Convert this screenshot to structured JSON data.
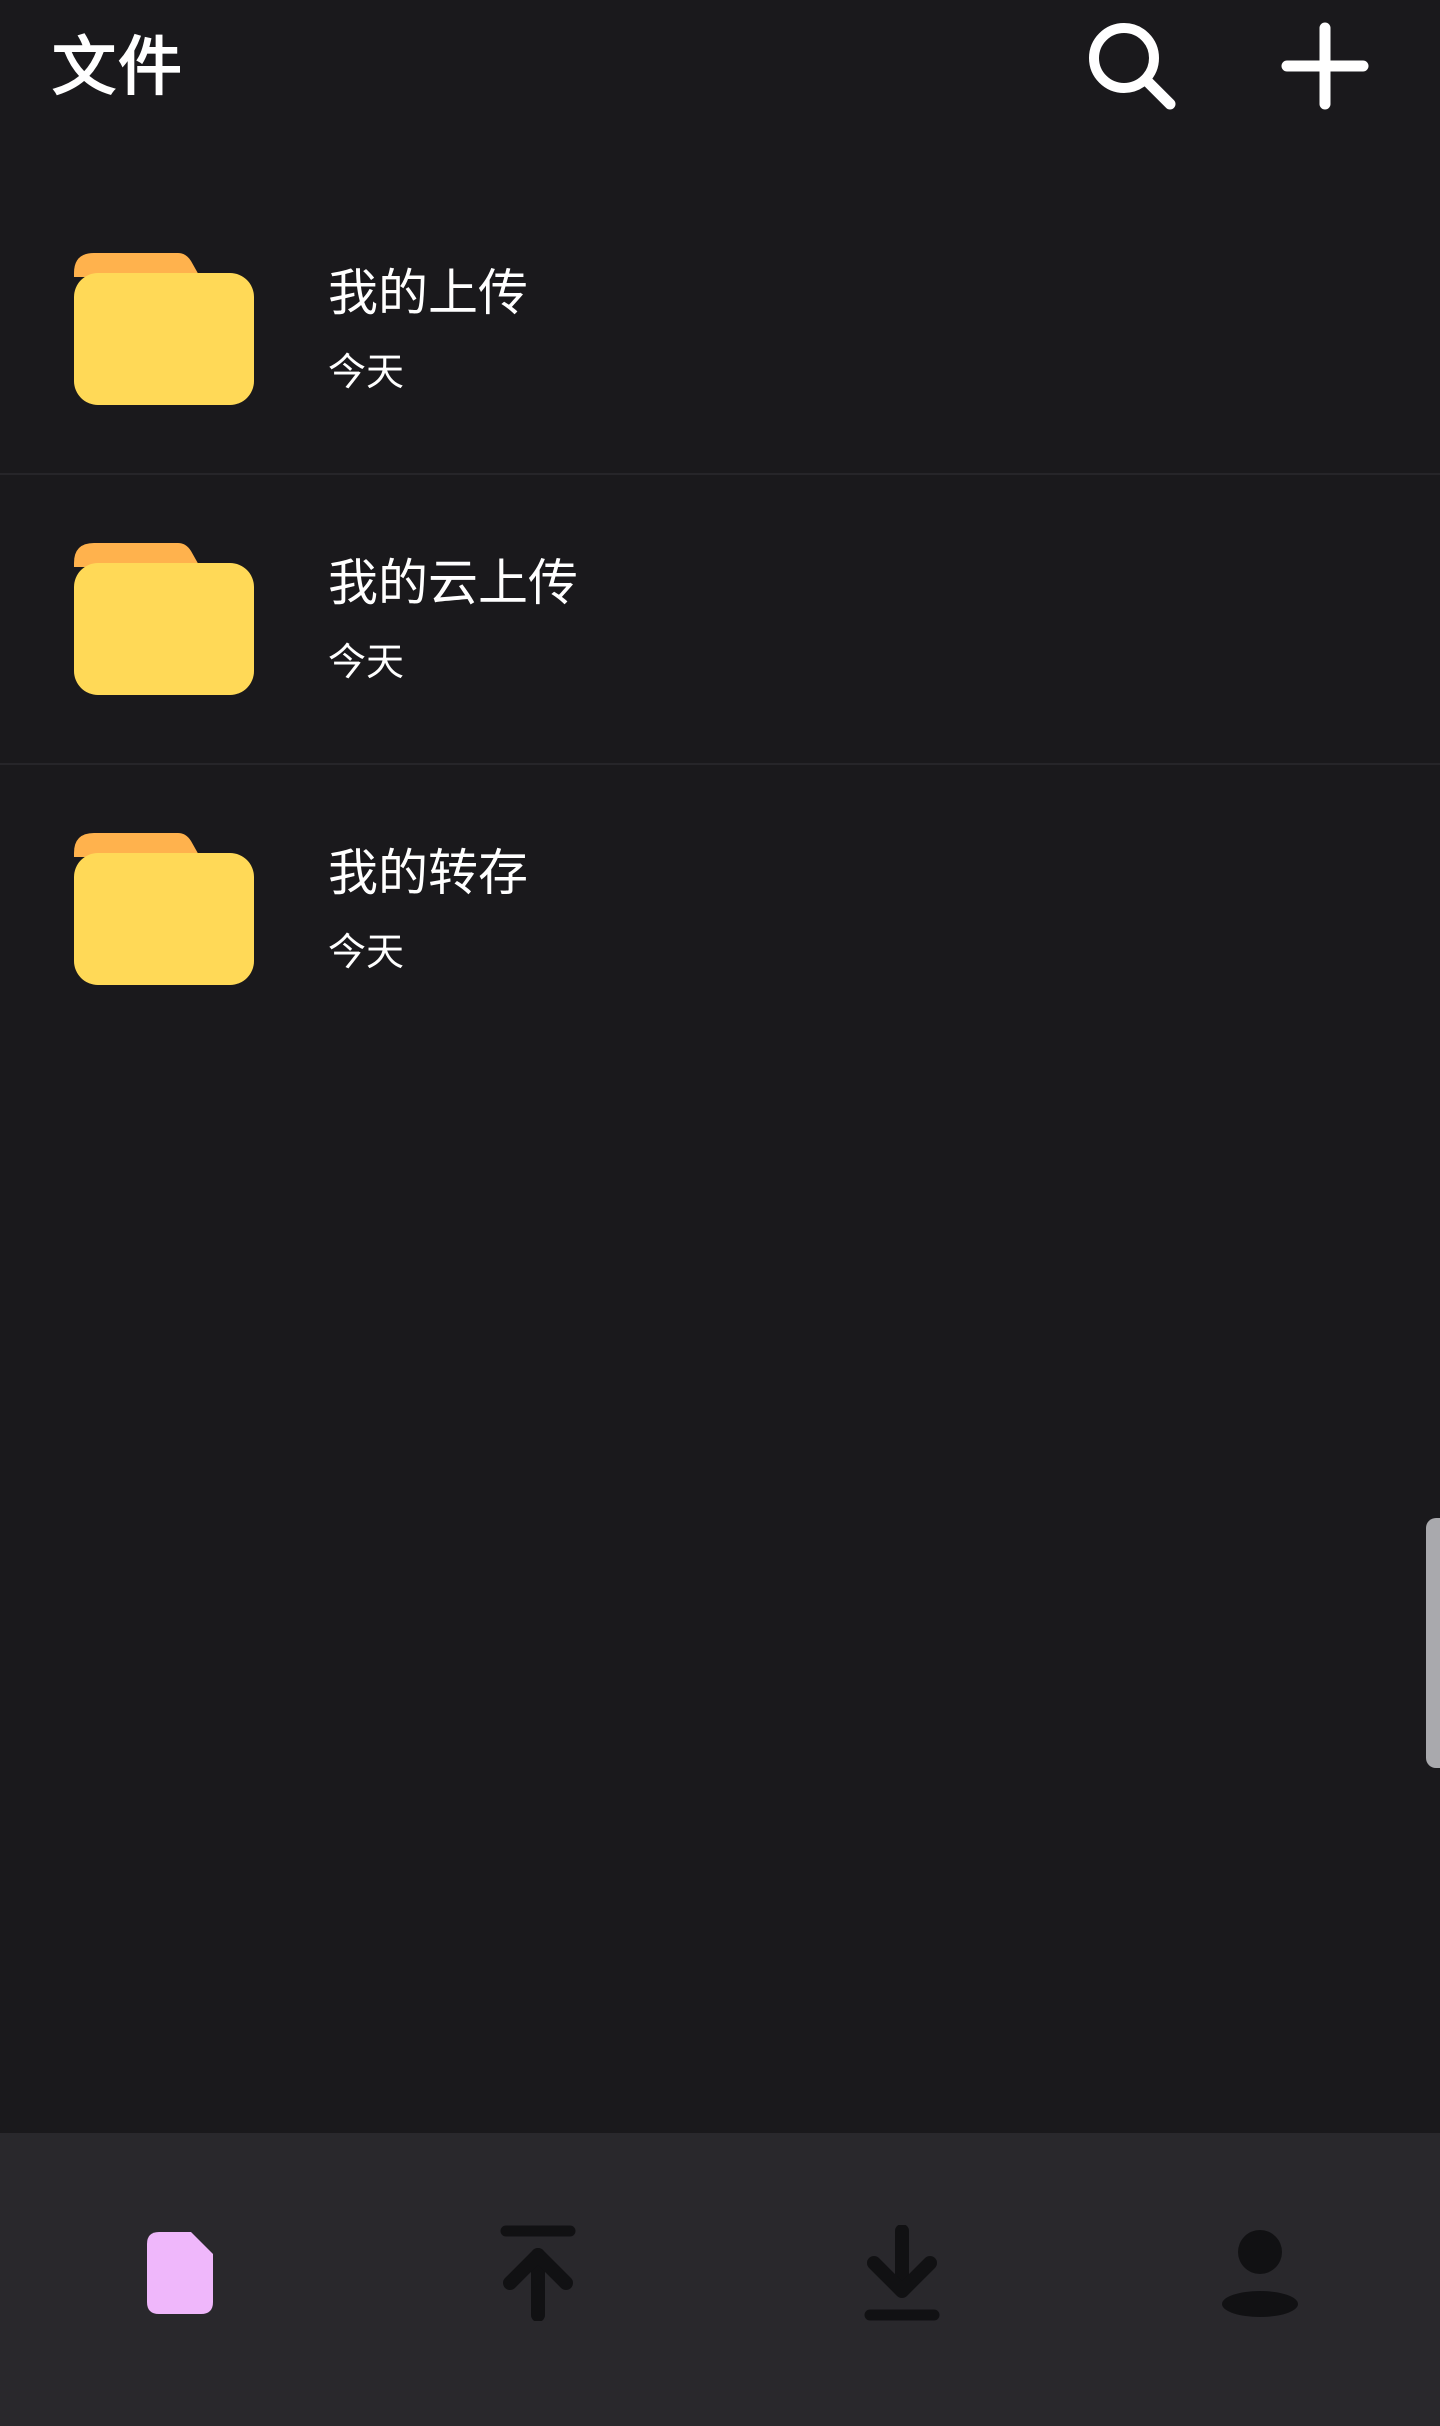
{
  "header": {
    "title": "文件",
    "search_icon": "search-icon",
    "add_icon": "plus-icon"
  },
  "files": [
    {
      "name": "我的上传",
      "date": "今天",
      "icon": "folder-icon"
    },
    {
      "name": "我的云上传",
      "date": "今天",
      "icon": "folder-icon"
    },
    {
      "name": "我的转存",
      "date": "今天",
      "icon": "folder-icon"
    }
  ],
  "bottom_nav": {
    "items": [
      {
        "icon": "file-icon",
        "active": true
      },
      {
        "icon": "upload-icon",
        "active": false
      },
      {
        "icon": "download-icon",
        "active": false
      },
      {
        "icon": "user-icon",
        "active": false
      }
    ]
  },
  "colors": {
    "background": "#1a191c",
    "nav_background": "#29282c",
    "folder_body": "#ffd957",
    "folder_tab": "#ffb24d",
    "active_tab": "#efb7fb",
    "inactive_tab": "#111113",
    "divider": "#262529",
    "scrollbar": "#a9a9ad"
  }
}
